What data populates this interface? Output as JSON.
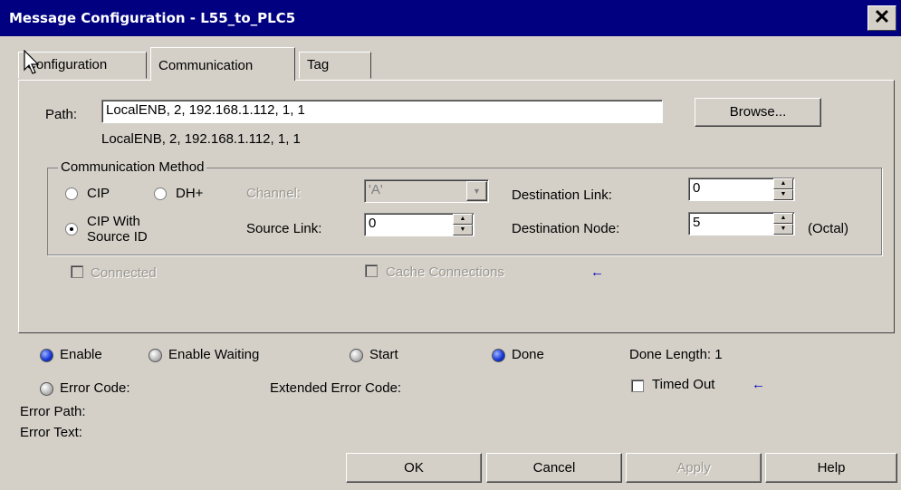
{
  "window": {
    "title": "Message Configuration - L55_to_PLC5"
  },
  "tabs": [
    {
      "label": "Configuration"
    },
    {
      "label": "Communication"
    },
    {
      "label": "Tag"
    }
  ],
  "path": {
    "label": "Path:",
    "value": "LocalENB, 2, 192.168.1.112, 1, 1",
    "resolved": "LocalENB, 2, 192.168.1.112, 1, 1",
    "browse_label": "Browse..."
  },
  "comm_method": {
    "group_label": "Communication Method",
    "cip_label": "CIP",
    "dhplus_label": "DH+",
    "channel_label": "Channel:",
    "channel_value": "'A'",
    "cip_source_label": [
      "CIP With",
      "Source ID"
    ],
    "source_link_label": "Source Link:",
    "source_link_value": "0",
    "dest_link_label": "Destination Link:",
    "dest_link_value": "0",
    "dest_node_label": "Destination Node:",
    "dest_node_value": "5",
    "octal_label": "(Octal)"
  },
  "options": {
    "connected_label": "Connected",
    "cache_label": "Cache Connections",
    "arrow": "←"
  },
  "status": {
    "enable": "Enable",
    "enable_waiting": "Enable Waiting",
    "start": "Start",
    "done": "Done",
    "done_length": "Done Length: 1",
    "error_code": "Error Code:",
    "extended_error_code": "Extended Error Code:",
    "timed_out": "Timed Out",
    "arrow": "←",
    "error_path": "Error Path:",
    "error_text": "Error Text:"
  },
  "buttons": {
    "ok": "OK",
    "cancel": "Cancel",
    "apply": "Apply",
    "help": "Help"
  },
  "colors": {
    "title_bar": "#000080",
    "face": "#d4d0c8",
    "led_on": "#1a3ad8",
    "arrow": "#0000c0"
  }
}
